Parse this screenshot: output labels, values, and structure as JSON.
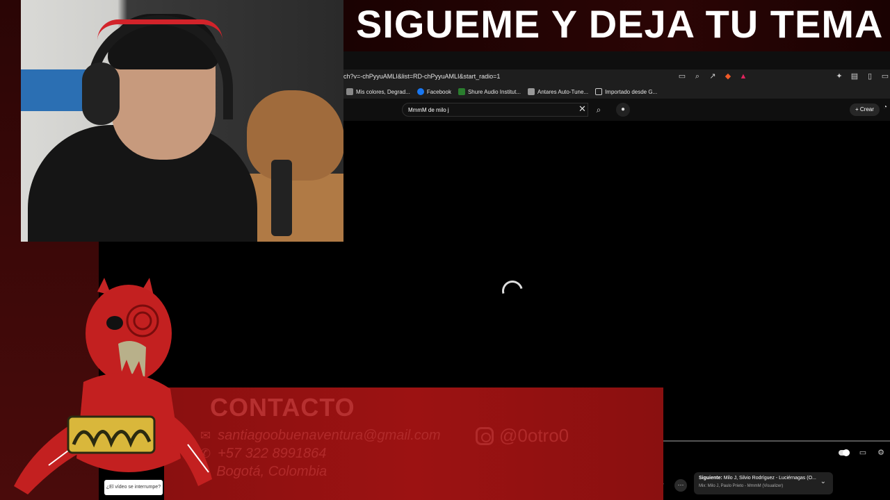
{
  "overlay": {
    "banner_text": "SIGUEME Y DEJA TU TEMA"
  },
  "browser": {
    "url": "ch?v=-chPyyuAMLI&list=RD-chPyyuAMLI&start_radio=1",
    "bookmarks": [
      {
        "label": "Mis colores, Degrad...",
        "color": "#888888"
      },
      {
        "label": "Facebook",
        "color": "#1877f2"
      },
      {
        "label": "Shure Audio Institut...",
        "color": "#2a7d2e"
      },
      {
        "label": "Antares Auto-Tune...",
        "color": "#999999"
      },
      {
        "label": "Importado desde G...",
        "color": "#cfcfcf"
      }
    ]
  },
  "youtube": {
    "search_value": "MmmM de milo j",
    "create_label": "Crear",
    "next_up": {
      "prefix": "Siguiente:",
      "title": "Milo J, Silvio Rodríguez - Luciérnagas (O...",
      "subtitle": "Mix: Milo J, Paulo Prieto - MmmM (Visualizer)"
    },
    "tooltip": "¿El vídeo se interrumpe?",
    "partial_button": "r"
  },
  "contact": {
    "title": "CONTACTO",
    "email": "santiagoobuenaventura@gmail.com",
    "phone": "+57 322 8991864",
    "location": "Bogotá, Colombia",
    "instagram": "@0otro0"
  },
  "colors": {
    "accent_red": "#9c1212",
    "banner_bg": "#1a0202"
  }
}
